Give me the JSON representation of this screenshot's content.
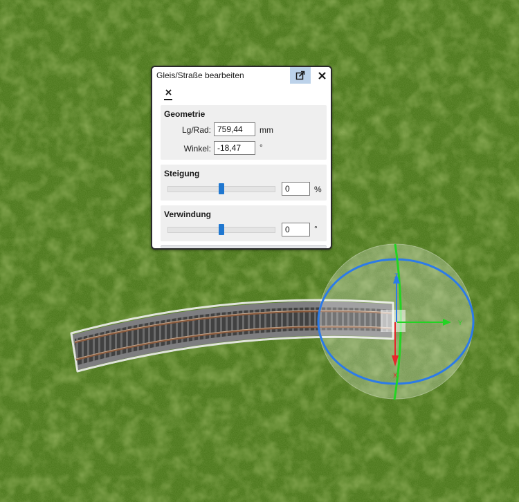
{
  "dialog": {
    "title": "Gleis/Straße bearbeiten",
    "popout_icon": "popout-icon",
    "close_icon": "close-icon",
    "clear_icon": "clear-x-icon"
  },
  "geometrie": {
    "title": "Geometrie",
    "length_label": "Lg/Rad:",
    "length_value": "759,44",
    "length_unit": "mm",
    "angle_label": "Winkel:",
    "angle_value": "-18,47",
    "angle_unit": "°"
  },
  "steigung": {
    "title": "Steigung",
    "value": "0",
    "unit": "%",
    "slider_fraction": 0.5
  },
  "verwindung": {
    "title": "Verwindung",
    "value": "0",
    "unit": "°",
    "slider_fraction": 0.5
  },
  "gizmo": {
    "axis_y": "Y",
    "axis_x": "X",
    "axis_z": "Z",
    "color_x": "#e8262a",
    "color_y": "#22d422",
    "color_z": "#2c7be8"
  },
  "colors": {
    "grass": "#4f7a1f",
    "accent": "#1f77d0"
  }
}
